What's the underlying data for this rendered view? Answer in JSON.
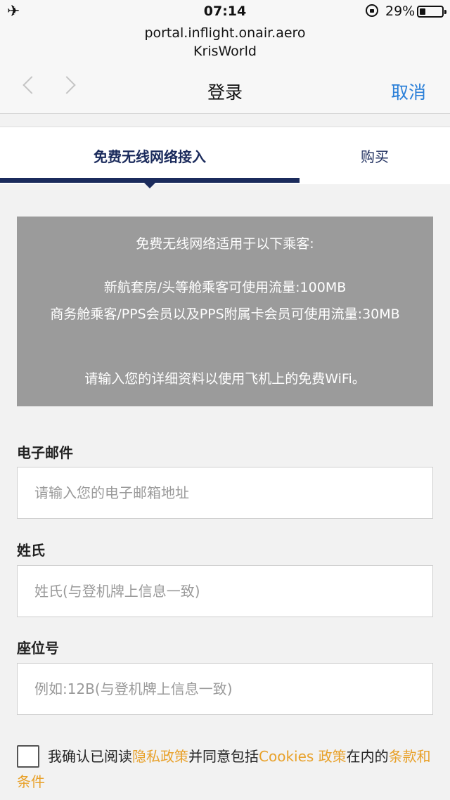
{
  "status_bar": {
    "mode_icon": "airplane-icon",
    "time": "07:14",
    "rotation_lock_icon": "rotation-lock-icon",
    "battery_percent": "29%",
    "battery_icon": "battery-icon",
    "battery_level": 0.29
  },
  "browser": {
    "url": "portal.inflight.onair.aero",
    "site_name": "KrisWorld",
    "title": "登录",
    "cancel_label": "取消",
    "back_icon": "chevron-left-icon",
    "forward_icon": "chevron-right-icon"
  },
  "tabs": [
    {
      "label": "免费无线网络接入",
      "active": true
    },
    {
      "label": "购买",
      "active": false
    }
  ],
  "info_box": {
    "line1": "免费无线网络适用于以下乘客:",
    "line2": "新航套房/头等舱乘客可使用流量:100MB",
    "line3": "商务舱乘客/PPS会员以及PPS附属卡会员可使用流量:30MB",
    "line4": "请输入您的详细资料以使用飞机上的免费WiFi。"
  },
  "form": {
    "email_label": "电子邮件",
    "email_placeholder": "请输入您的电子邮箱地址",
    "surname_label": "姓氏",
    "surname_placeholder": "姓氏(与登机牌上信息一致)",
    "seat_label": "座位号",
    "seat_placeholder": "例如:12B(与登机牌上信息一致)"
  },
  "consent": {
    "prefix": "我确认已阅读",
    "privacy_link": "隐私政策",
    "middle": "并同意包括",
    "cookies_link": "Cookies 政策",
    "suffix": "在内的",
    "terms_link": "条款和条件",
    "checked": false
  },
  "colors": {
    "accent": "#1b2b5c",
    "link": "#e8a12a",
    "ios_blue": "#2a7fd8",
    "info_bg": "#9b9b9b"
  }
}
